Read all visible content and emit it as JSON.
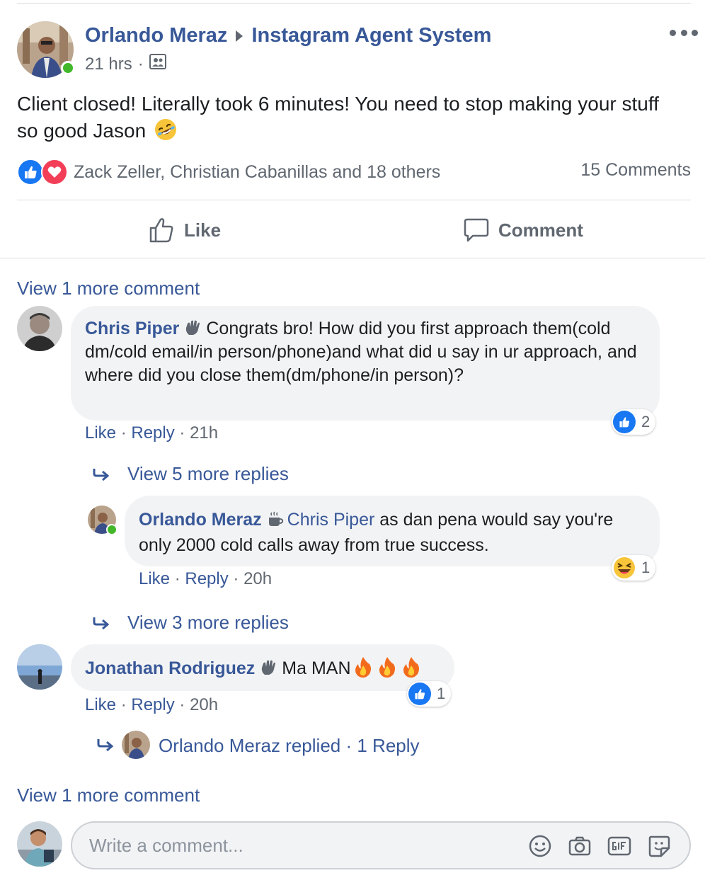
{
  "post": {
    "author": "Orlando Meraz",
    "group": "Instagram Agent System",
    "time": "21 hrs",
    "time_sep": "·",
    "text": "Client closed! Literally took 6 minutes! You need to stop making your stuff so good Jason",
    "reactions_text": "Zack Zeller, Christian Cabanillas and 18 others",
    "comments_text": "15 Comments",
    "like_label": "Like",
    "comment_label": "Comment"
  },
  "comments": {
    "view_more_top": "View 1 more comment",
    "view_more_bottom": "View 1 more comment",
    "c1": {
      "name": "Chris Piper",
      "text": "Congrats bro! How did you first approach them(cold dm/cold email/in person/phone)and what did u say in ur approach, and where did you close them(dm/phone/in person)?",
      "like": "Like",
      "reply": "Reply",
      "time": "21h",
      "reaction_count": "2",
      "view_replies": "View 5 more replies"
    },
    "r1": {
      "name": "Orlando Meraz",
      "mention": "Chris Piper",
      "text": "as dan pena would say you're only 2000 cold calls away from true success.",
      "like": "Like",
      "reply": "Reply",
      "time": "20h",
      "reaction_count": "1",
      "view_replies": "View 3 more replies"
    },
    "c2": {
      "name": "Jonathan Rodriguez",
      "text": "Ma MAN",
      "like": "Like",
      "reply": "Reply",
      "time": "20h",
      "reaction_count": "1",
      "replied_summary": "Orlando Meraz replied",
      "replied_sep": "·",
      "reply_count": "1 Reply"
    },
    "sep": "·"
  },
  "composer": {
    "placeholder": "Write a comment..."
  },
  "colors": {
    "link": "#385898",
    "secondary_text": "#606770",
    "bubble_bg": "#f2f3f5",
    "like_blue": "#1877f2",
    "love_red": "#f33e58",
    "online_green": "#42b72a"
  },
  "icons": [
    "more-icon",
    "members-icon",
    "like-reaction-icon",
    "love-reaction-icon",
    "thumbs-up-icon",
    "speech-bubble-icon",
    "wave-badge-icon",
    "coffee-badge-icon",
    "laughing-reaction-icon",
    "reply-arrow-icon",
    "fire-icon",
    "smiley-icon",
    "camera-icon",
    "gif-icon",
    "sticker-icon",
    "rofl-emoji-icon"
  ]
}
